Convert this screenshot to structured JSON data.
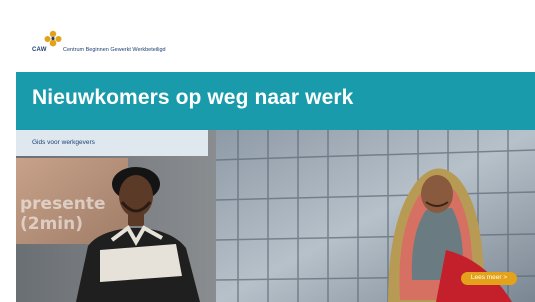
{
  "logo": {
    "abbr": "CAW",
    "name": "Centrum Beginnen Gewerkt Werkbeteiligd",
    "icon": "caw-emblem-icon"
  },
  "banner": {
    "title": "Nieuwkomers op weg naar werk"
  },
  "photo": {
    "subtitle": "Gids voor werkgevers",
    "screen_text": "presente\n(2min)",
    "more_button_label": "Lees meer >"
  },
  "colors": {
    "banner": "#1a9bac",
    "subtitle_bar": "#dfe8ef",
    "button": "#e3a21a",
    "brand_navy": "#1d3f73"
  }
}
